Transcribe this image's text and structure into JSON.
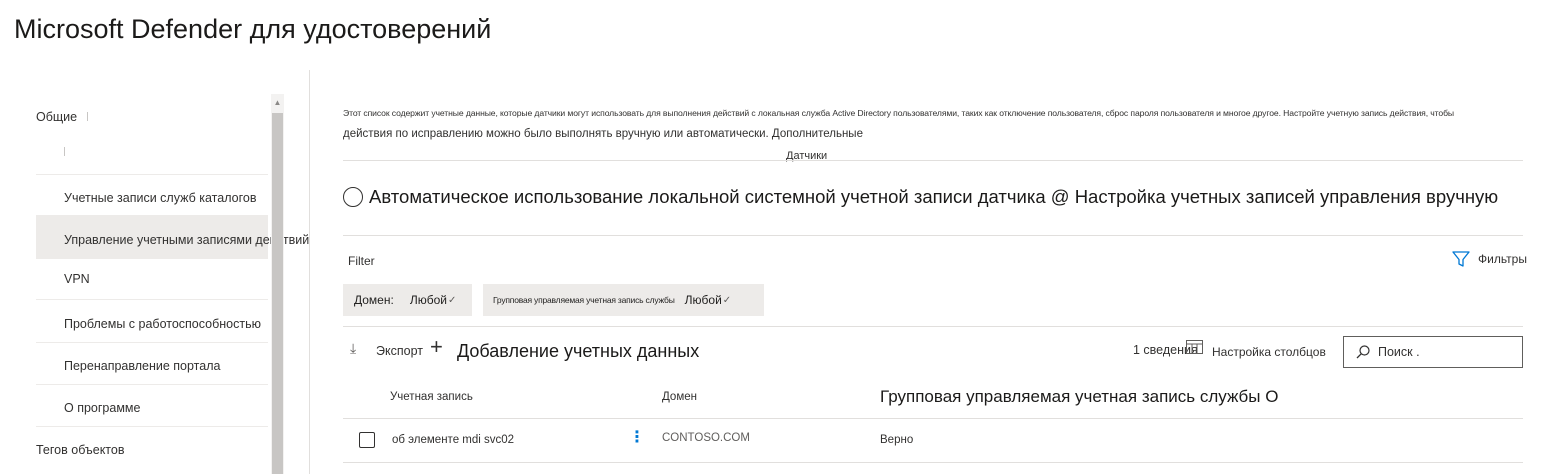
{
  "app": {
    "title": "Microsoft Defender для удостоверений"
  },
  "sidebar": {
    "section_general": "Общие",
    "items": [
      {
        "label": "Учетные записи служб каталогов"
      },
      {
        "label": "Управление учетными записями действий"
      },
      {
        "label": "VPN"
      },
      {
        "label": "Проблемы с работоспособностью"
      },
      {
        "label": "Перенаправление портала"
      },
      {
        "label": "О программе"
      }
    ],
    "section_entity_tags": "Тегов объектов",
    "scroll_up": "▲"
  },
  "main": {
    "description_line1": "Этот список содержит учетные данные, которые датчики могут использовать для выполнения действий с локальная служба Active Directory пользователями, таких как отключение пользователя, сброс пароля пользователя и многое другое. Настройте учетную запись действия, чтобы",
    "description_line2": "действия по исправлению можно было выполнять вручную или автоматически. Дополнительные",
    "sensors_link": "Датчики",
    "radio_label": "Автоматическое использование локальной системной учетной записи датчика @ Настройка учетных записей управления вручную",
    "filter_label": "Filter",
    "filters_button": "Фильтры",
    "chips": {
      "domain_label": "Домен:",
      "domain_value": "Любой",
      "gmsa_label": "Групповая управляемая учетная запись службы",
      "gmsa_value": "Любой",
      "chevron": "✓"
    },
    "toolbar": {
      "export_icon": "⤓",
      "export_label": "Экспорт",
      "add_icon": "+",
      "add_label": "Добавление учетных данных",
      "count": "1 сведения",
      "customize_columns": "Настройка столбцов",
      "search_placeholder": "Поиск ."
    },
    "table": {
      "headers": {
        "account": "Учетная запись",
        "domain": "Домен",
        "gmsa": "Групповая управляемая учетная запись службы О"
      },
      "rows": [
        {
          "account": "об элементе mdi svc02",
          "kebab": "⋮",
          "domain": "CONTOSO.COM",
          "gmsa": "Верно"
        }
      ]
    }
  },
  "colors": {
    "accent": "#0078d4",
    "selected_bg": "#edebe9",
    "divider": "#e1dfdd"
  }
}
